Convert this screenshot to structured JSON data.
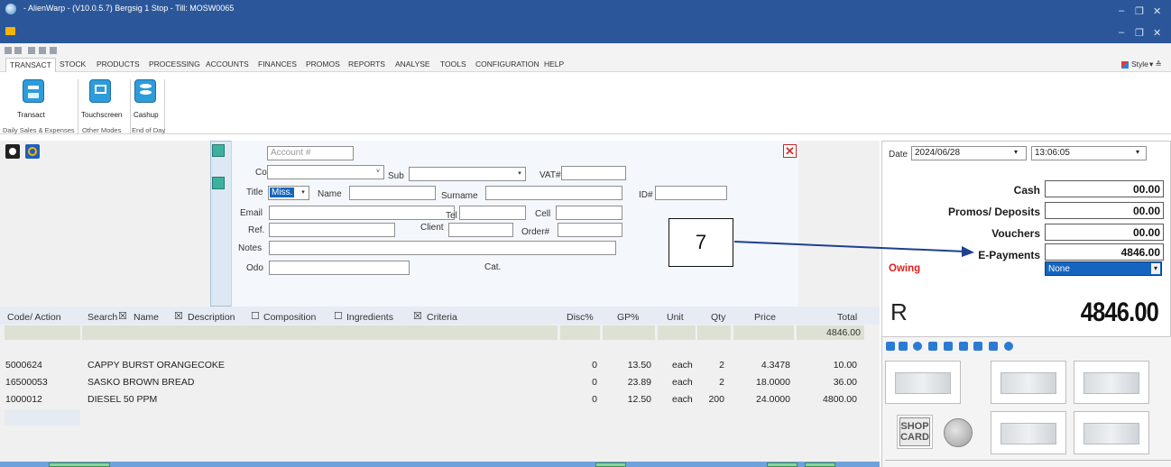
{
  "window": {
    "title": "- AlienWarp - (V10.0.5.7) Bergsig 1 Stop - Till: MOSW0065",
    "min_label": "–",
    "max_label": "❐",
    "close_label": "✕"
  },
  "menu": {
    "items": [
      "TRANSACT",
      "STOCK",
      "PRODUCTS",
      "PROCESSING",
      "ACCOUNTS",
      "FINANCES",
      "PROMOS",
      "REPORTS",
      "ANALYSE",
      "TOOLS",
      "CONFIGURATION",
      "HELP"
    ],
    "style_label": "Style",
    "style_arrow": "▾ ≙"
  },
  "ribbon": {
    "buttons": [
      {
        "label": "Transact",
        "icon": "cash-register-icon"
      },
      {
        "label": "Touchscreen",
        "icon": "touchscreen-icon"
      },
      {
        "label": "Cashup",
        "icon": "coins-icon"
      }
    ],
    "groups": [
      "Daily Sales & Expenses",
      "Other Modes",
      "End of Day"
    ]
  },
  "account": {
    "account_placeholder": "Account #",
    "labels": {
      "co": "Co",
      "sub": "Sub",
      "vat": "VAT#",
      "title": "Title",
      "name": "Name",
      "surname": "Surname",
      "id": "ID#",
      "email": "Email",
      "tel": "Tel",
      "cell": "Cell",
      "ref": "Ref.",
      "client": "Client",
      "order": "Order#",
      "notes": "Notes",
      "odo": "Odo",
      "cat": "Cat."
    },
    "title_value": "Miss.",
    "close_label": "✕"
  },
  "grid": {
    "headers": {
      "code": "Code/ Action",
      "search": "Search",
      "disc": "Disc%",
      "gp": "GP%",
      "unit": "Unit",
      "qty": "Qty",
      "price": "Price",
      "total": "Total"
    },
    "filters": [
      {
        "label": "Name",
        "checked": true
      },
      {
        "label": "Description",
        "checked": true
      },
      {
        "label": "Composition",
        "checked": false
      },
      {
        "label": "Ingredients",
        "checked": false
      },
      {
        "label": "Criteria",
        "checked": true
      }
    ],
    "checked_glyph": "☒",
    "unchecked_glyph": "☐",
    "total_value": "4846.00",
    "rows": [
      {
        "code": "5000624",
        "desc": "CAPPY BURST ORANGECOKE",
        "disc": "0",
        "gp": "13.50",
        "unit": "each",
        "qty": "2",
        "price": "4.3478",
        "total": "10.00"
      },
      {
        "code": "16500053",
        "desc": "SASKO BROWN BREAD",
        "disc": "0",
        "gp": "23.89",
        "unit": "each",
        "qty": "2",
        "price": "18.0000",
        "total": "36.00"
      },
      {
        "code": "1000012",
        "desc": "DIESEL 50 PPM",
        "disc": "0",
        "gp": "12.50",
        "unit": "each",
        "qty": "200",
        "price": "24.0000",
        "total": "4800.00"
      }
    ]
  },
  "payment": {
    "date_label": "Date",
    "date_value": "2024/06/28",
    "time_value": "13:06:05",
    "cash_label": "Cash",
    "cash_value": "00.00",
    "promos_label": "Promos/ Deposits",
    "promos_value": "00.00",
    "vouchers_label": "Vouchers",
    "vouchers_value": "00.00",
    "epay_label": "E-Payments",
    "epay_value": "4846.00",
    "owing_label": "Owing",
    "owing_select": "None",
    "currency": "R",
    "grand_total": "4846.00"
  },
  "cash_buttons": {
    "shop_card_line1": "SHOP",
    "shop_card_line2": "CARD"
  },
  "annotation": {
    "number": "7"
  },
  "colors": {
    "titlebar": "#2b579a",
    "owing": "#e0201b",
    "select_blue": "#1565c0",
    "arrow": "#1f3f8f"
  }
}
